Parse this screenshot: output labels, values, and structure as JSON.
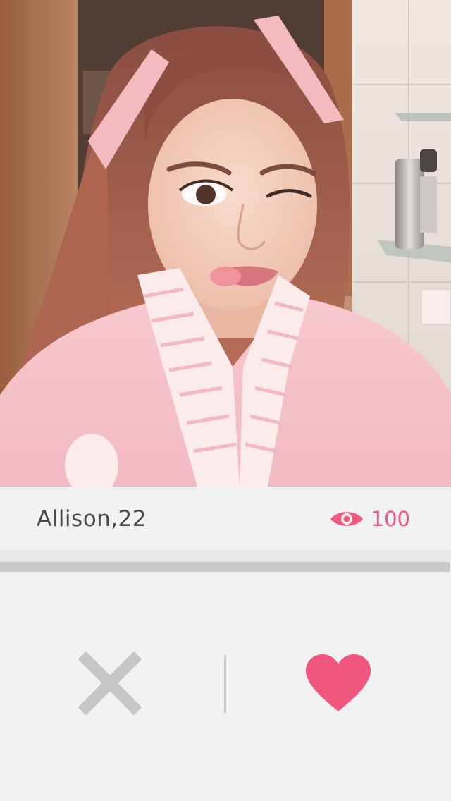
{
  "profile": {
    "name_age": "Allison,22",
    "photo": "selfie-photo"
  },
  "views": {
    "icon": "eye-icon",
    "count": "100"
  },
  "actions": {
    "dislike_icon": "close-x-icon",
    "like_icon": "heart-icon"
  },
  "colors": {
    "accent": "#f0577f",
    "text": "#4a4a4a",
    "muted": "#c8c8c8",
    "background": "#f2f2f2"
  }
}
